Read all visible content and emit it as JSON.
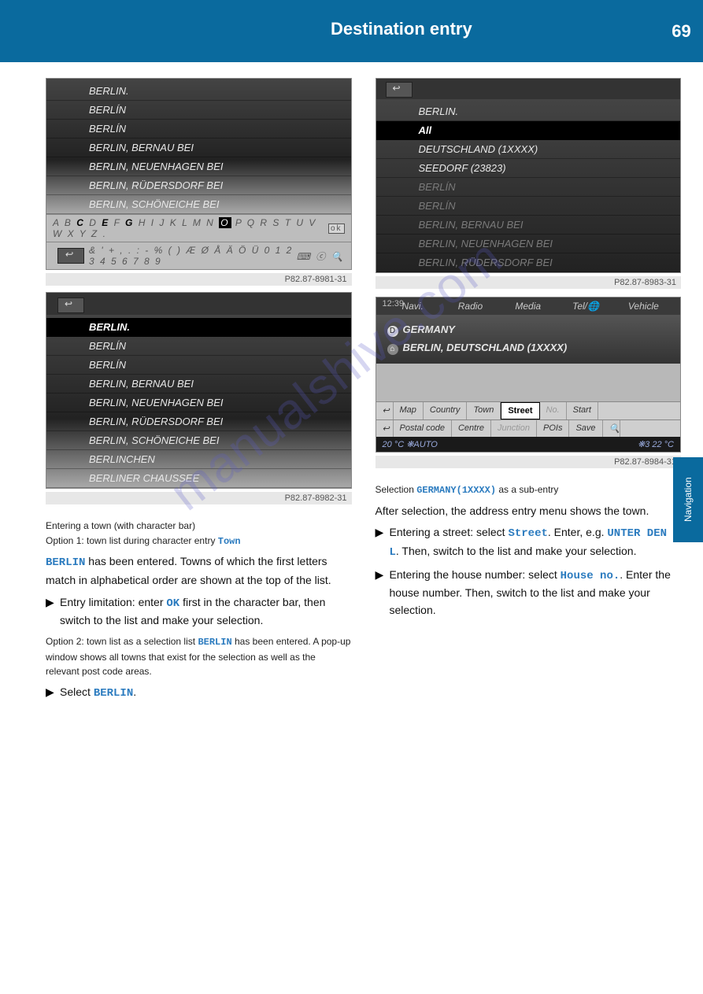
{
  "header": {
    "title": "Destination entry",
    "page_no": "69"
  },
  "side_tab": "Navigation",
  "watermark": "manualshive.com",
  "shotA": {
    "caption": "P82.87-8981-31",
    "items": [
      "BERLIN.",
      "BERLÍN",
      "BERLÍN",
      "BERLIN, BERNAU BEI",
      "BERLIN, NEUENHAGEN BEI",
      "BERLIN, RÜDERSDORF BEI",
      "BERLIN, SCHÖNEICHE BEI"
    ],
    "kb1": "A B C D E F G H I J K L M N O P Q R S T U V W X Y Z .",
    "kb1_ok": "ok",
    "kb2": "& ' + , . : - % ( ) Æ Ø Å Ä Ö Ü 0 1 2 3 4 5 6 7 8 9"
  },
  "shotB": {
    "caption": "P82.87-8982-31",
    "items": [
      "BERLIN.",
      "BERLÍN",
      "BERLÍN",
      "BERLIN, BERNAU BEI",
      "BERLIN, NEUENHAGEN BEI",
      "BERLIN, RÜDERSDORF BEI",
      "BERLIN, SCHÖNEICHE BEI",
      "BERLINCHEN",
      "BERLINER CHAUSSEE"
    ]
  },
  "shotC": {
    "caption": "P82.87-8983-31",
    "top": [
      "BERLIN.",
      "All",
      "DEUTSCHLAND (1XXXX)",
      "SEEDORF (23823)"
    ],
    "dim": [
      "BERLÍN",
      "BERLÍN",
      "BERLIN, BERNAU BEI",
      "BERLIN, NEUENHAGEN BEI",
      "BERLIN, RÜDERSDORF BEI"
    ]
  },
  "shotD": {
    "caption": "P82.87-8984-31",
    "time": "12:39",
    "tabs": [
      "Navi.",
      "Radio",
      "Media",
      "Tel/🌐",
      "Vehicle"
    ],
    "info_country_badge": "D",
    "info_country": "GERMANY",
    "info_town": "BERLIN, DEUTSCHLAND (1XXXX)",
    "row1": [
      "↩",
      "Map",
      "Country",
      "Town",
      "Street",
      "No.",
      "Start"
    ],
    "row1_hi": "Street",
    "row2": [
      "↩",
      "Postal code",
      "Centre",
      "Junction",
      "POIs",
      "Save",
      "🔍"
    ],
    "status_left": "20 °C  ❋AUTO",
    "status_right": "❋3    22 °C"
  },
  "left_text": {
    "subcap1_a": "Entering a town (with character bar)",
    "subcap1_b": "Option 1: town list during character entry ",
    "town_label": "Town",
    "berlin": "BERLIN",
    "p1a": " has been entered. Towns of which the first letters match in alphabetical order are shown at the top of the list.",
    "step1a": "Entry limitation: enter ",
    "ok": "OK",
    "step1b": " first in the character bar, then switch to the list and make your selection.",
    "opt2a": "Option 2: town list as a selection list ",
    "opt2b": " has been entered. A pop-up window shows all towns that exist for the selection as well as the relevant post code areas.",
    "step2": "Select ",
    "berlin2": "BERLIN",
    "step2b": "."
  },
  "right_text": {
    "selcap": "Selection ",
    "germany": "GERMANY(1XXXX)",
    "selcap2": " as a sub-entry",
    "p_after": "After selection, the address entry menu shows the town.",
    "entstreet_a": "Entering a street: select ",
    "street": "Street",
    "entstreet_b": ". Enter, e.g. ",
    "unter": "UNTER DEN L",
    "entstreet_c": ". Then, switch to the list and make your selection.",
    "house_a": "Entering the house number: select ",
    "house": "House no.",
    "house_b": ". Enter the house number. Then, switch to the list and make your selection."
  }
}
